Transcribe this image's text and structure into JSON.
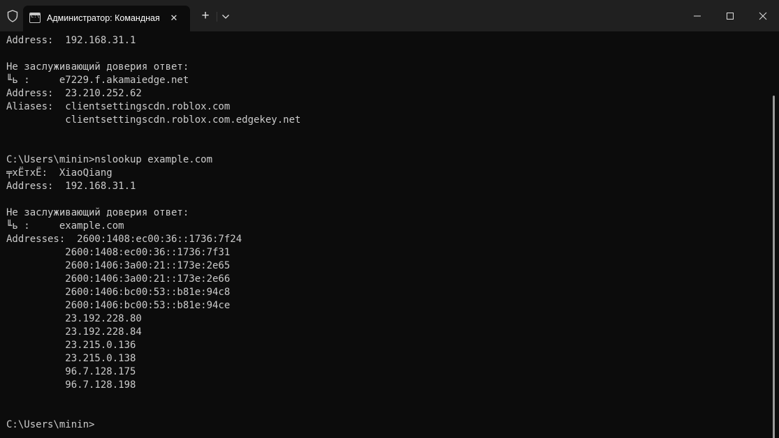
{
  "window": {
    "tab_title": "Администратор: Командная строка",
    "tab_icon_text": "C:\\",
    "tab_close_glyph": "✕",
    "new_tab_glyph": "+",
    "icons": [
      "shield-icon",
      "terminal-icon",
      "close-icon",
      "plus-icon",
      "chevron-down-icon",
      "minimize-icon",
      "maximize-icon",
      "close-icon"
    ]
  },
  "console": {
    "lines": [
      "Address:  192.168.31.1",
      "",
      "Не заслуживающий доверия ответ:",
      "╙ь :     e7229.f.akamaiedge.net",
      "Address:  23.210.252.62",
      "Aliases:  clientsettingscdn.roblox.com",
      "          clientsettingscdn.roblox.com.edgekey.net",
      "",
      "",
      "C:\\Users\\minin>nslookup example.com",
      "╤xЁтxЁ:  XiaoQiang",
      "Address:  192.168.31.1",
      "",
      "Не заслуживающий доверия ответ:",
      "╙ь :     example.com",
      "Addresses:  2600:1408:ec00:36::1736:7f24",
      "          2600:1408:ec00:36::1736:7f31",
      "          2600:1406:3a00:21::173e:2e65",
      "          2600:1406:3a00:21::173e:2e66",
      "          2600:1406:bc00:53::b81e:94c8",
      "          2600:1406:bc00:53::b81e:94ce",
      "          23.192.228.80",
      "          23.192.228.84",
      "          23.215.0.136",
      "          23.215.0.138",
      "          96.7.128.175",
      "          96.7.128.198",
      "",
      "",
      "C:\\Users\\minin>"
    ]
  },
  "colors": {
    "titlebar": "#202020",
    "console_bg": "#0c0c0c",
    "console_text": "#cccccc"
  }
}
